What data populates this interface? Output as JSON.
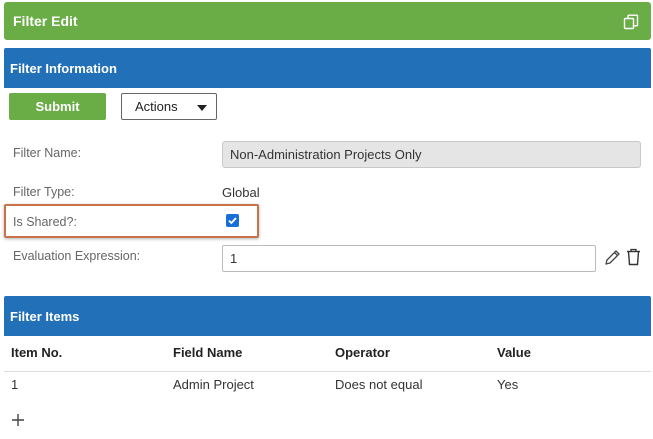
{
  "header": {
    "title": "Filter Edit",
    "copy_icon": "copy-icon"
  },
  "filter_information": {
    "title": "Filter Information",
    "submit_label": "Submit",
    "actions_label": "Actions",
    "fields": {
      "filter_name_label": "Filter Name:",
      "filter_name_value": "Non-Administration Projects Only",
      "filter_type_label": "Filter Type:",
      "filter_type_value": "Global",
      "is_shared_label": "Is Shared?:",
      "is_shared_checked": true,
      "evaluation_expression_label": "Evaluation Expression:",
      "evaluation_expression_value": "1"
    },
    "colors": {
      "header": "#2270b8",
      "submit": "#6aad46",
      "highlight": "#c8734a"
    }
  },
  "filter_items": {
    "title": "Filter Items",
    "columns": [
      "Item No.",
      "Field Name",
      "Operator",
      "Value"
    ],
    "rows": [
      [
        "1",
        "Admin Project",
        "Does not equal",
        "Yes"
      ]
    ]
  }
}
